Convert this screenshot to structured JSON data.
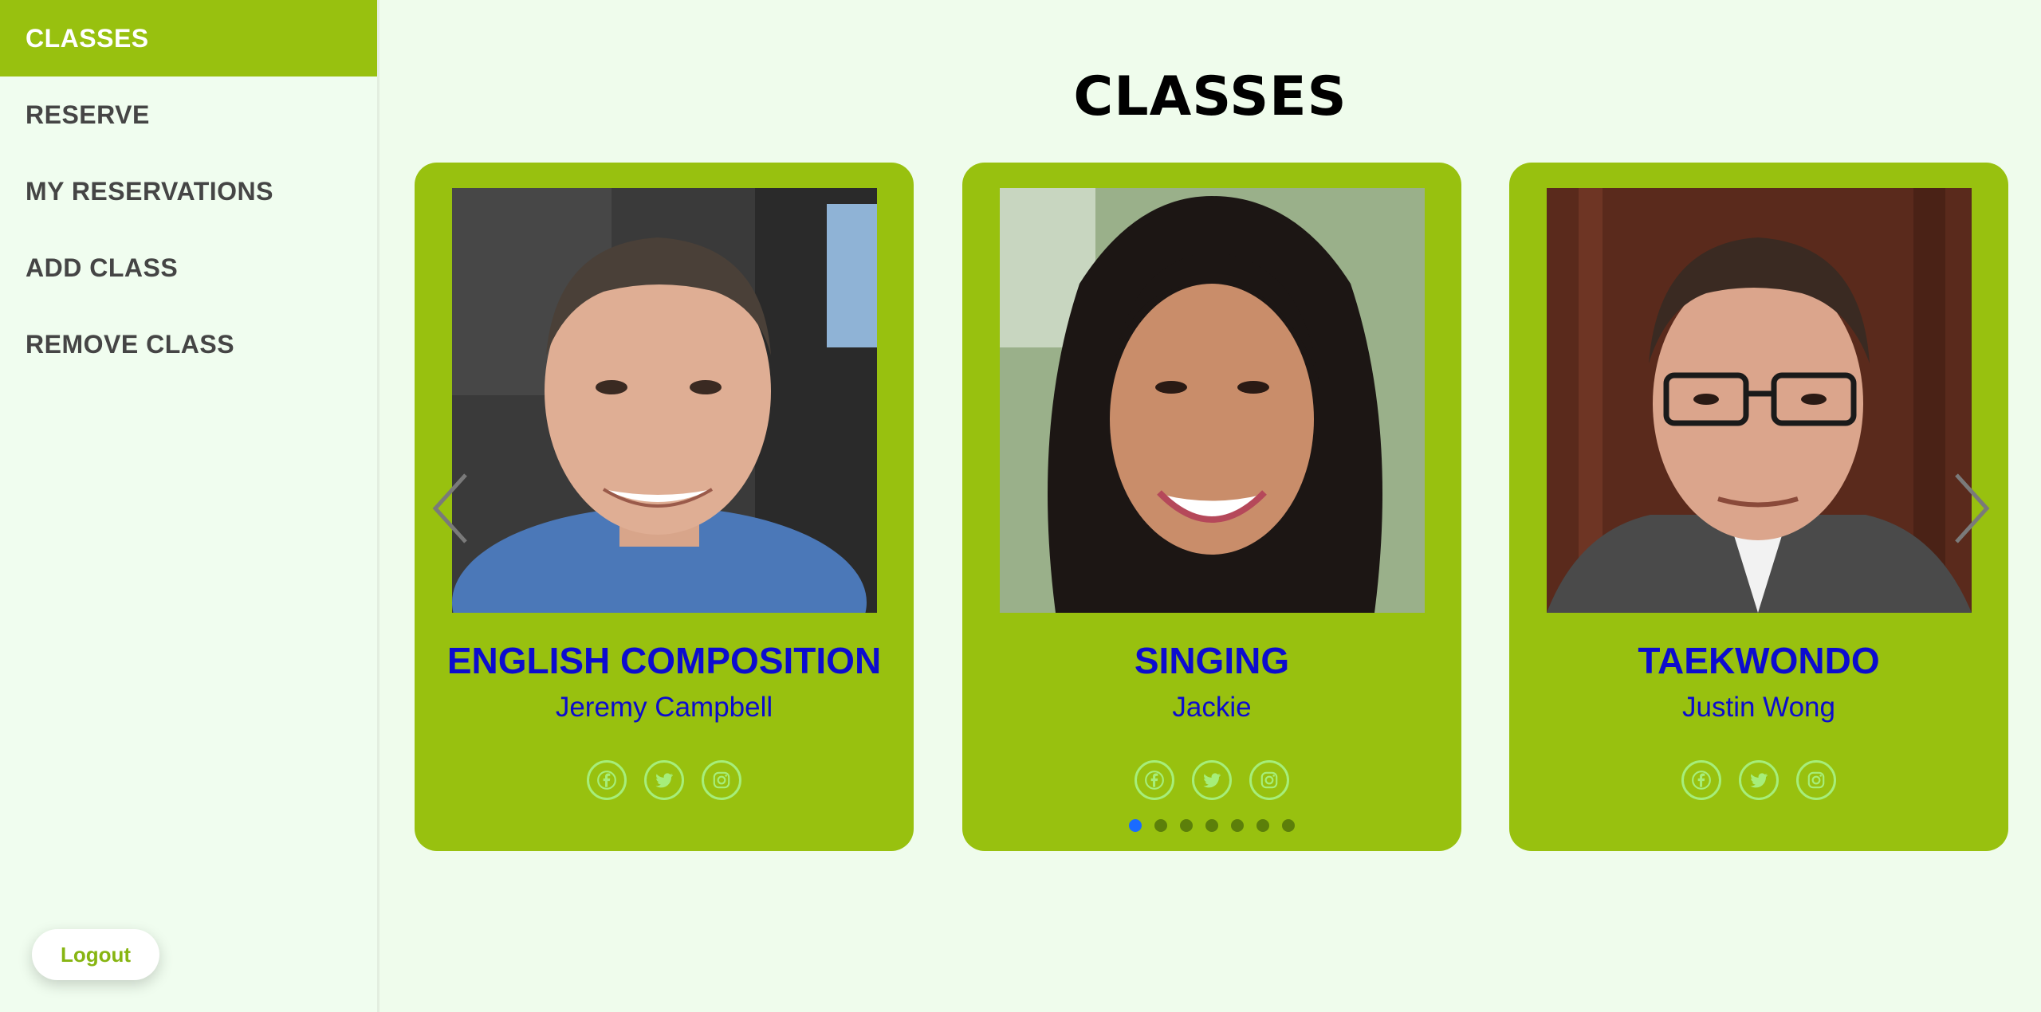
{
  "sidebar": {
    "items": [
      {
        "label": "CLASSES"
      },
      {
        "label": "RESERVE"
      },
      {
        "label": "MY RESERVATIONS"
      },
      {
        "label": "ADD CLASS"
      },
      {
        "label": "REMOVE CLASS"
      }
    ],
    "logout_label": "Logout"
  },
  "main": {
    "title": "CLASSES",
    "cards": [
      {
        "title": "ENGLISH COMPOSITION",
        "teacher": "Jeremy Campbell"
      },
      {
        "title": "SINGING",
        "teacher": "Jackie"
      },
      {
        "title": "TAEKWONDO",
        "teacher": "Justin Wong"
      }
    ],
    "carousel": {
      "total_slides": 7,
      "active_slide": 1
    }
  },
  "colors": {
    "accent": "#98c10f",
    "title_blue": "#0c0ccf",
    "background": "#effcec",
    "social_icon": "#a6ee7a",
    "active_dot": "#1a6bff"
  },
  "icons": [
    "chevron-left-icon",
    "chevron-right-icon",
    "facebook-icon",
    "twitter-icon",
    "instagram-icon"
  ]
}
